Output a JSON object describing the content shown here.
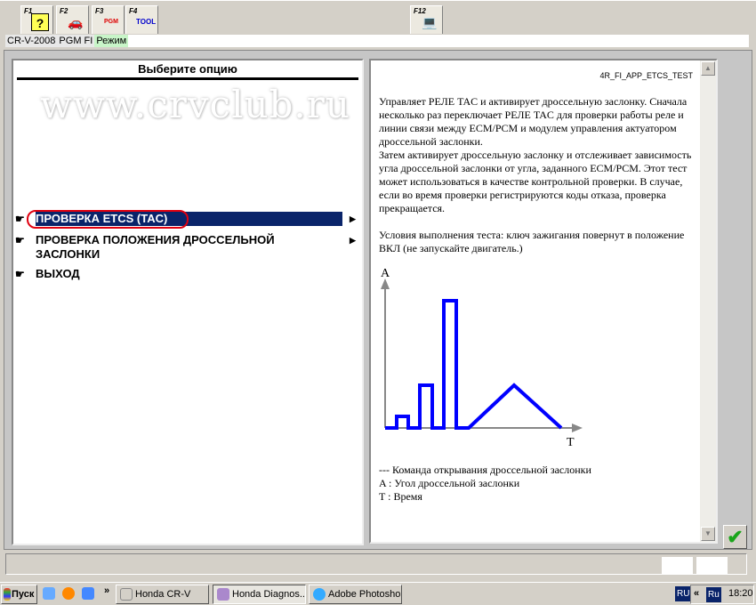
{
  "toolbar": {
    "tabs": [
      {
        "key": "F1",
        "icon": "help-icon"
      },
      {
        "key": "F2",
        "icon": "car-icon"
      },
      {
        "key": "F3",
        "icon": "pgm-at-icon"
      },
      {
        "key": "F4",
        "icon": "tool-icon"
      },
      {
        "key": "F12",
        "icon": "computer-icon"
      }
    ],
    "tool_icon_text": "TOOL"
  },
  "statusline": {
    "model": "CR-V-2008",
    "system": "PGM FI",
    "mode": "Режим"
  },
  "left": {
    "title": "Выберите опцию",
    "watermark": "www.crvclub.ru",
    "options": [
      {
        "label": "ПРОВЕРКА ETCS (TAC)",
        "selected": true,
        "submenu": true
      },
      {
        "label": "ПРОВЕРКА ПОЛОЖЕНИЯ ДРОССЕЛЬНОЙ ЗАСЛОНКИ",
        "selected": false,
        "submenu": true
      },
      {
        "label": "ВЫХОД",
        "selected": false,
        "submenu": false
      }
    ]
  },
  "right": {
    "code": "4R_FI_APP_ETCS_TEST",
    "description": "Управляет РЕЛЕ TAC и активирует дроссельную заслонку. Сначала несколько раз переключает РЕЛЕ TAC для проверки работы реле и линии связи между ECM/PCM и модулем управления актуатором дроссельной заслонки.\nЗатем активирует дроссельную заслонку и отслеживает зависимость угла дроссельной заслонки от угла, заданного ECM/PCM. Этот тест может использоваться в качестве контрольной проверки. В случае, если во время проверки регистрируются коды отказа, проверка прекращается.\n\nУсловия выполнения теста: ключ зажигания повернут в положение ВКЛ (не запускайте двигатель.)",
    "diagram": {
      "y_label": "A",
      "x_label": "T",
      "line_color": "#0000ff"
    },
    "legend": [
      "--- Команда открывания дроссельной заслонки",
      "A : Угол дроссельной заслонки",
      "T : Время"
    ]
  },
  "ok_button": {
    "icon": "checkmark-icon",
    "color": "#1aa51a"
  },
  "taskbar": {
    "start": "Пуск",
    "items": [
      {
        "label": "Honda CR-V",
        "active": false
      },
      {
        "label": "Honda Diagnos...",
        "active": true
      },
      {
        "label": "Adobe Photoshop",
        "active": false
      }
    ],
    "chevron": "»",
    "lang": "RU",
    "tray_lang": "Ru",
    "tray_chevron": "«",
    "clock": "18:20"
  }
}
